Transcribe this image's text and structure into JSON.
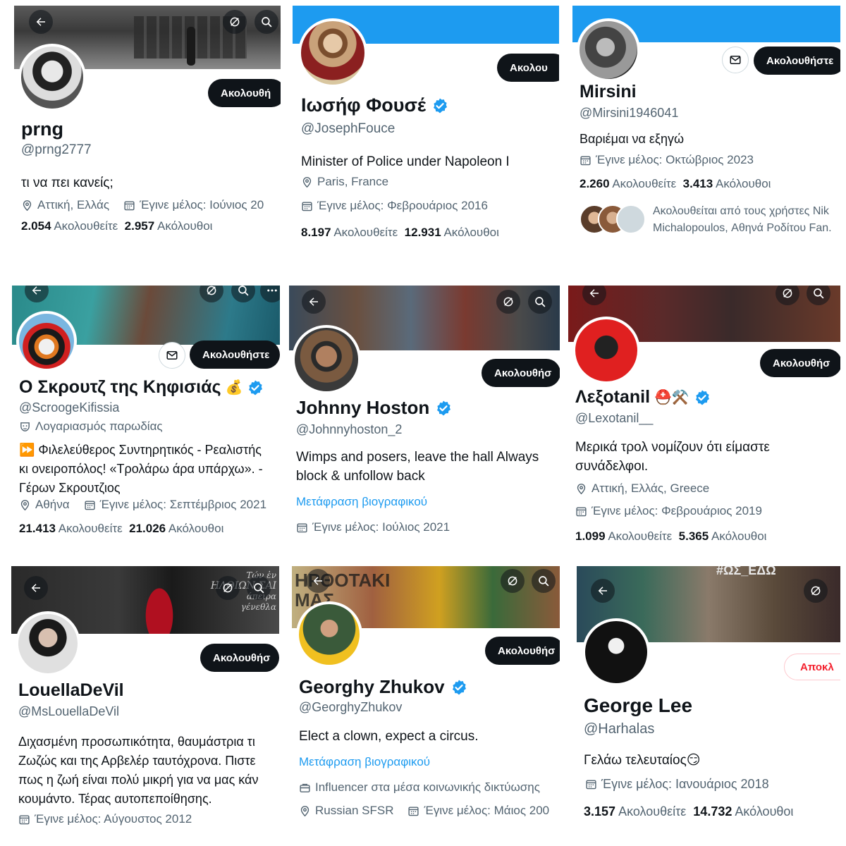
{
  "profiles": [
    {
      "name": "prng",
      "handle": "@prng2777",
      "follow_label": "Ακολουθή",
      "bio": "τι να πει κανείς;",
      "location": "Αττική, Ελλάς",
      "joined": "Έγινε μέλος: Ιούνιος 20",
      "following": "2.054",
      "following_label": "Ακολουθείτε",
      "followers": "2.957",
      "followers_label": "Ακόλουθοι"
    },
    {
      "name": "Ιωσήφ Φουσέ",
      "handle": "@JosephFouce",
      "follow_label": "Ακολου",
      "bio": "Minister of Police under Napoleon I",
      "location": "Paris, France",
      "joined": "Έγινε μέλος: Φεβρουάριος 2016",
      "following": "8.197",
      "following_label": "Ακολουθείτε",
      "followers": "12.931",
      "followers_label": "Ακόλουθοι"
    },
    {
      "name": "Mirsini",
      "handle": "@Mirsini1946041",
      "follow_label": "Ακολουθήστε",
      "bio": "Βαριέμαι να εξηγώ",
      "joined": "Έγινε μέλος: Οκτώβριος 2023",
      "following": "2.260",
      "following_label": "Ακολουθείτε",
      "followers": "3.413",
      "followers_label": "Ακόλουθοι",
      "followed_by_line1": "Ακολουθείται από τους χρήστες Nik",
      "followed_by_line2": "Michalopoulos, Αθηνά Ροδίτου Fan."
    },
    {
      "name": "Ο Σκρουτζ της Κηφισιάς",
      "name_emoji": "💰",
      "handle": "@ScroogeKifissia",
      "parody": "Λογαριασμός παρωδίας",
      "follow_label": "Ακολουθήστε",
      "bio": "⏩ Φιλελεύθερος Συντηρητικός - Ρεαλιστής\nκι ονειροπόλος! «Τρολάρω άρα υπάρχω». -\nΓέρων Σκρουτζιος",
      "location": "Αθήνα",
      "joined": "Έγινε μέλος: Σεπτέμβριος 2021",
      "following": "21.413",
      "following_label": "Ακολουθείτε",
      "followers": "21.026",
      "followers_label": "Ακόλουθοι"
    },
    {
      "name": "Johnny Hoston",
      "handle": "@Johnnyhoston_2",
      "follow_label": "Ακολουθήσ",
      "bio": "Wimps and posers, leave the hall Always\nblock & unfollow back",
      "translate": "Μετάφραση βιογραφικού",
      "joined": "Έγινε μέλος: Ιούλιος 2021"
    },
    {
      "name": "Λεξοtanil",
      "name_emoji": "⛑️⚒️",
      "handle": "@Lexotanil__",
      "follow_label": "Ακολουθήσ",
      "bio": "Μερικά τρολ νομίζουν ότι είμαστε\nσυνάδελφοι.",
      "location": "Αττική, Ελλάς, Greece",
      "joined": "Έγινε μέλος: Φεβρουάριος 2019",
      "following": "1.099",
      "following_label": "Ακολουθείτε",
      "followers": "5.365",
      "followers_label": "Ακόλουθοι"
    },
    {
      "name": "LouellaDeVil",
      "handle": "@MsLouellaDeVil",
      "follow_label": "Ακολουθήσ",
      "banner_text1": "Τών ἐν",
      "banner_text2": "ΗΛΘΙΩΝ ΣΑΙ",
      "banner_text3": "άπειρα γένεθλα",
      "bio": "Διχασμένη προσωπικότητα, θαυμάστρια τι\nΖωζώς και της Αρβελέρ ταυτόχρονα. Πιστε\nπως η ζωή είναι πολύ μικρή για να μας κάν\nκουμάντο. Τέρας αυτοπεποίθησης.",
      "joined": "Έγινε μέλος: Αύγουστος 2012"
    },
    {
      "name": "Georghy Zhukov",
      "handle": "@GeorghyZhukov",
      "follow_label": "Ακολουθήσ",
      "banner_text": "ΗΡΘΟΤΑΚΙ ΜΑΣ",
      "bio": "Elect a clown, expect a circus.",
      "translate": "Μετάφραση βιογραφικού",
      "category": "Influencer στα μέσα κοινωνικής δικτύωσης",
      "location": "Russian SFSR",
      "joined": "Έγινε μέλος: Μάιος 200"
    },
    {
      "name": "George Lee",
      "handle": "@Harhalas",
      "block_label": "Αποκλ",
      "banner_text": "#ΩΣ_ΕΔΩ",
      "bio": "Γελάω τελευταίος😏",
      "joined": "Έγινε μέλος: Ιανουάριος 2018",
      "following": "3.157",
      "following_label": "Ακολουθείτε",
      "followers": "14.732",
      "followers_label": "Ακόλουθοι"
    }
  ],
  "colors": {
    "verified": "#1d9bf0",
    "banner_blue": "#1d9bf0",
    "text_primary": "#0f1419",
    "text_secondary": "#536471",
    "block_red": "#f4212e"
  }
}
